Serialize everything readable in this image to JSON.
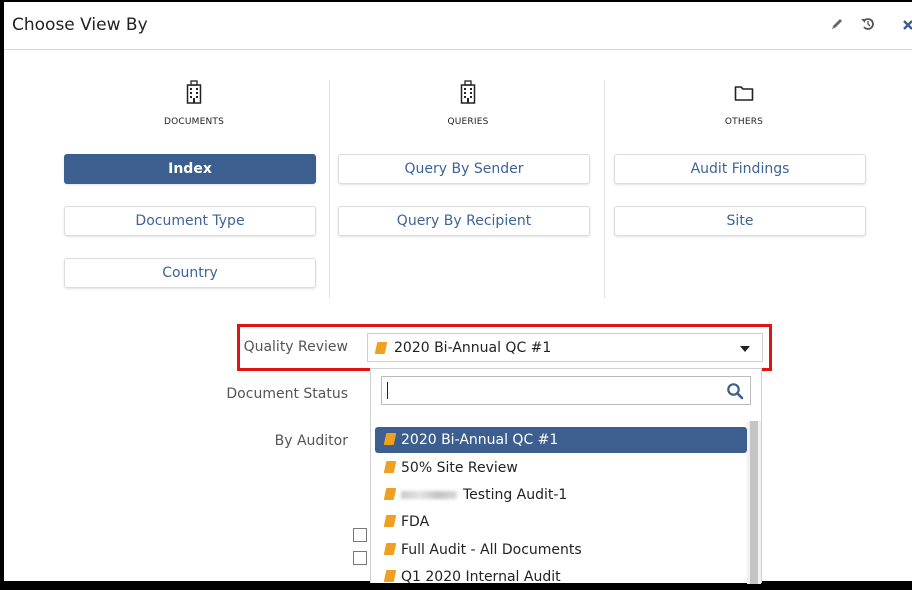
{
  "dialog": {
    "title": "Choose View By",
    "toolbar_icons": [
      "pencil-icon",
      "undo-icon",
      "close-icon"
    ]
  },
  "columns": [
    {
      "label": "DOCUMENTS",
      "icon": "building-icon",
      "buttons": [
        "Index",
        "Document Type",
        "Country"
      ]
    },
    {
      "label": "QUERIES",
      "icon": "building-icon",
      "buttons": [
        "Query By Sender",
        "Query By Recipient"
      ]
    },
    {
      "label": "OTHERS",
      "icon": "folder-icon",
      "buttons": [
        "Audit Findings",
        "Site"
      ]
    }
  ],
  "active_button": "Index",
  "form": {
    "quality_review_label": "Quality Review",
    "quality_review_value": "2020 Bi-Annual QC #1",
    "document_status_label": "Document Status",
    "by_auditor_label": "By Auditor"
  },
  "dropdown": {
    "search_value": "",
    "options": [
      "2020 Bi-Annual QC #1",
      "50% Site Review",
      "Testing Audit-1",
      "FDA",
      "Full Audit - All Documents",
      "Q1 2020 Internal Audit"
    ],
    "selected_index": 0
  },
  "colors": {
    "accent": "#3d5f8f",
    "link_text": "#3d6399",
    "highlight_border": "#e01414",
    "book_icon": "#f0a020"
  }
}
